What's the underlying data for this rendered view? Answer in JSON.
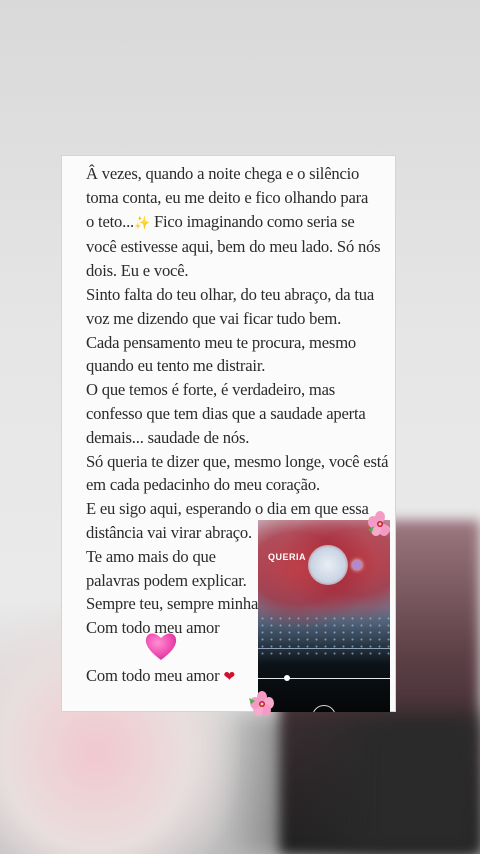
{
  "note": {
    "lines": [
      "Â vezes, quando a noite chega e o silêncio",
      "toma conta, eu me deito e fico olhando para",
      "o teto...",
      "Fico imaginando como seria se",
      "você estivesse aqui, bem do meu lado. Só nós",
      "dois. Eu e você.",
      "Sinto falta do teu olhar, do teu abraço, da tua",
      "voz me dizendo que vai ficar tudo bem.",
      "Cada pensamento meu te procura, mesmo",
      "quando eu tento me distrair.",
      "O que temos é forte, é verdadeiro, mas",
      "confesso que tem dias que a saudade aperta",
      "demais... saudade de nós.",
      "Só queria te dizer que, mesmo longe, você está",
      "em cada pedacinho do meu coração.",
      "E eu sigo aqui, esperando o dia em que essa",
      "distância vai virar abraço.",
      "Te amo mais do que",
      "palavras podem explicar.",
      "Sempre teu, sempre minha.",
      "Com todo meu amor",
      "Com todo meu amor"
    ],
    "sparkle_icon": "sparkles-icon",
    "heart_icon": "red-heart-icon"
  },
  "video": {
    "title": "QUERIA"
  },
  "colors": {
    "text": "#2b2b2b",
    "heart_red": "#d0102d",
    "pink_heart": "#f14fb3",
    "flower_pink": "#f49bc4"
  }
}
